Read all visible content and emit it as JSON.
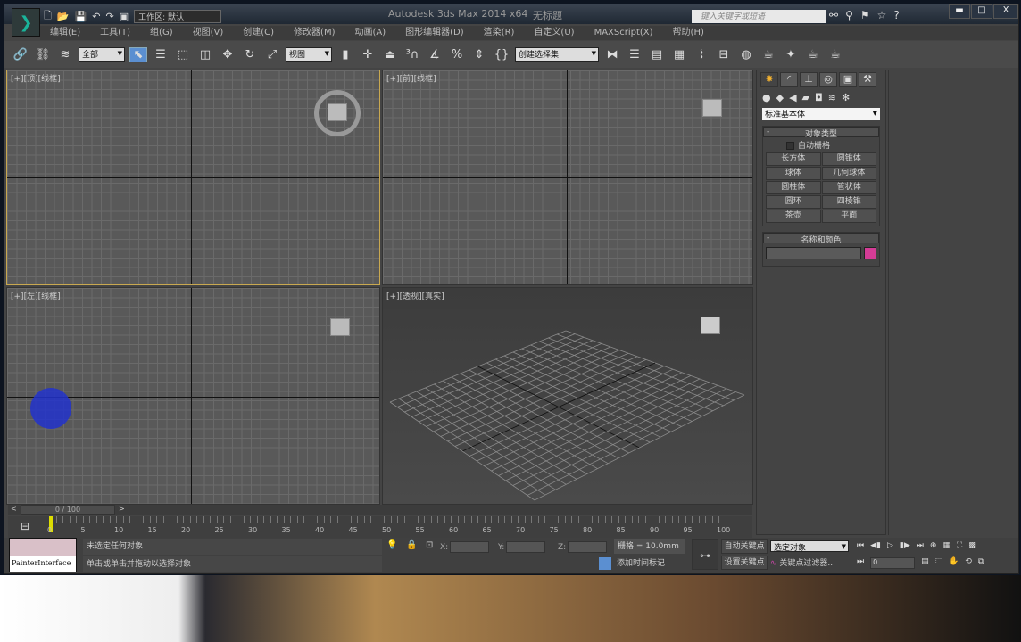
{
  "titlebar": {
    "workspace": "工作区: 默认",
    "app_title": "Autodesk 3ds Max 2014 x64",
    "doc_title": "无标题",
    "search_placeholder": "键入关键字或短语",
    "min": "▬",
    "max": "□",
    "close": "X"
  },
  "menu": [
    "编辑(E)",
    "工具(T)",
    "组(G)",
    "视图(V)",
    "创建(C)",
    "修改器(M)",
    "动画(A)",
    "图形编辑器(D)",
    "渲染(R)",
    "自定义(U)",
    "MAXScript(X)",
    "帮助(H)"
  ],
  "toolbar": {
    "filter": "全部",
    "ref_coord": "视图",
    "selection_set": "创建选择集"
  },
  "viewports": [
    {
      "label": "[+][顶][线框]"
    },
    {
      "label": "[+][前][线框]"
    },
    {
      "label": "[+][左][线框]"
    },
    {
      "label": "[+][透视][真实]"
    }
  ],
  "command_panel": {
    "category": "标准基本体",
    "rollout1": "对象类型",
    "autogrid": "自动栅格",
    "buttons": [
      "长方体",
      "圆锥体",
      "球体",
      "几何球体",
      "圆柱体",
      "管状体",
      "圆环",
      "四棱锥",
      "茶壶",
      "平面"
    ],
    "rollout2": "名称和颜色",
    "color": "#d43c96"
  },
  "timeline": {
    "slider": "0 / 100",
    "prev": "<",
    "next": ">",
    "ticks": [
      "0",
      "5",
      "10",
      "15",
      "20",
      "25",
      "30",
      "35",
      "40",
      "45",
      "50",
      "55",
      "60",
      "65",
      "70",
      "75",
      "80",
      "85",
      "90",
      "95",
      "100"
    ],
    "current": 0
  },
  "status": {
    "painter": "PainterInterface",
    "line1": "未选定任何对象",
    "line2": "单击或单击并拖动以选择对象",
    "x": "X:",
    "y": "Y:",
    "z": "Z:",
    "grid": "栅格 = 10.0mm",
    "add_time_tag": "添加时间标记",
    "auto_key": "自动关键点",
    "set_key": "设置关键点",
    "key_target": "选定对象",
    "key_filters": "关键点过滤器...",
    "frame": "0"
  }
}
